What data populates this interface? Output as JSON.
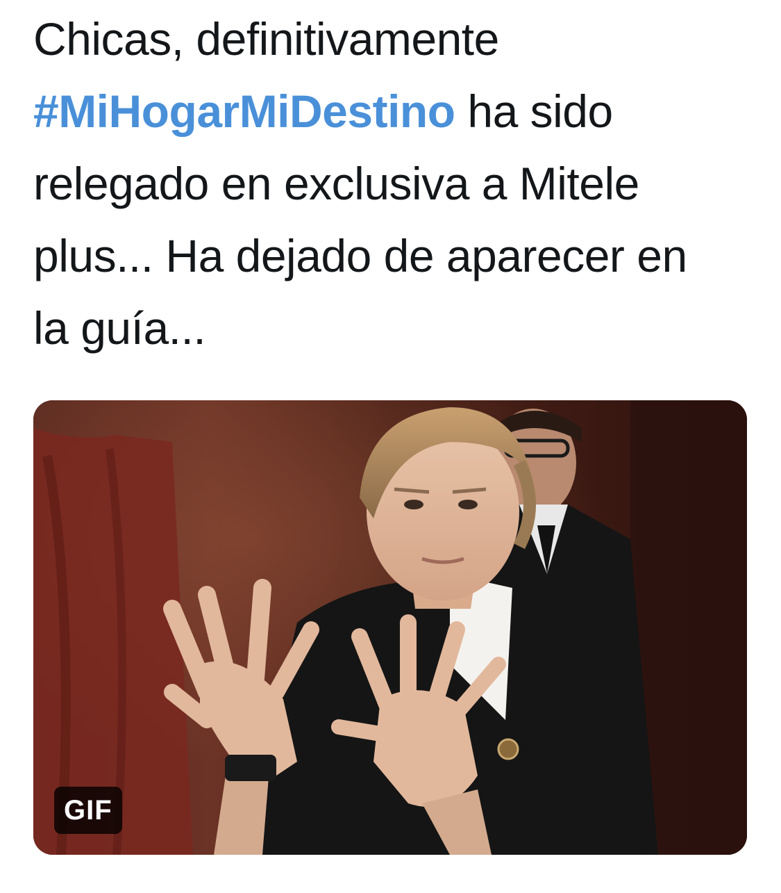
{
  "tweet": {
    "lines": [
      {
        "text": "Chicas, definitivamente"
      },
      {
        "hashtag": "#MiHogarMiDestino",
        "text": " ha sido"
      },
      {
        "text": "relegado en exclusiva a Mitele"
      },
      {
        "text": "plus... Ha dejado de aparecer en"
      },
      {
        "text": "la guía..."
      }
    ],
    "hashtag_color": "#4a90d9"
  },
  "media": {
    "badge": "GIF",
    "icon": "gif-image"
  }
}
